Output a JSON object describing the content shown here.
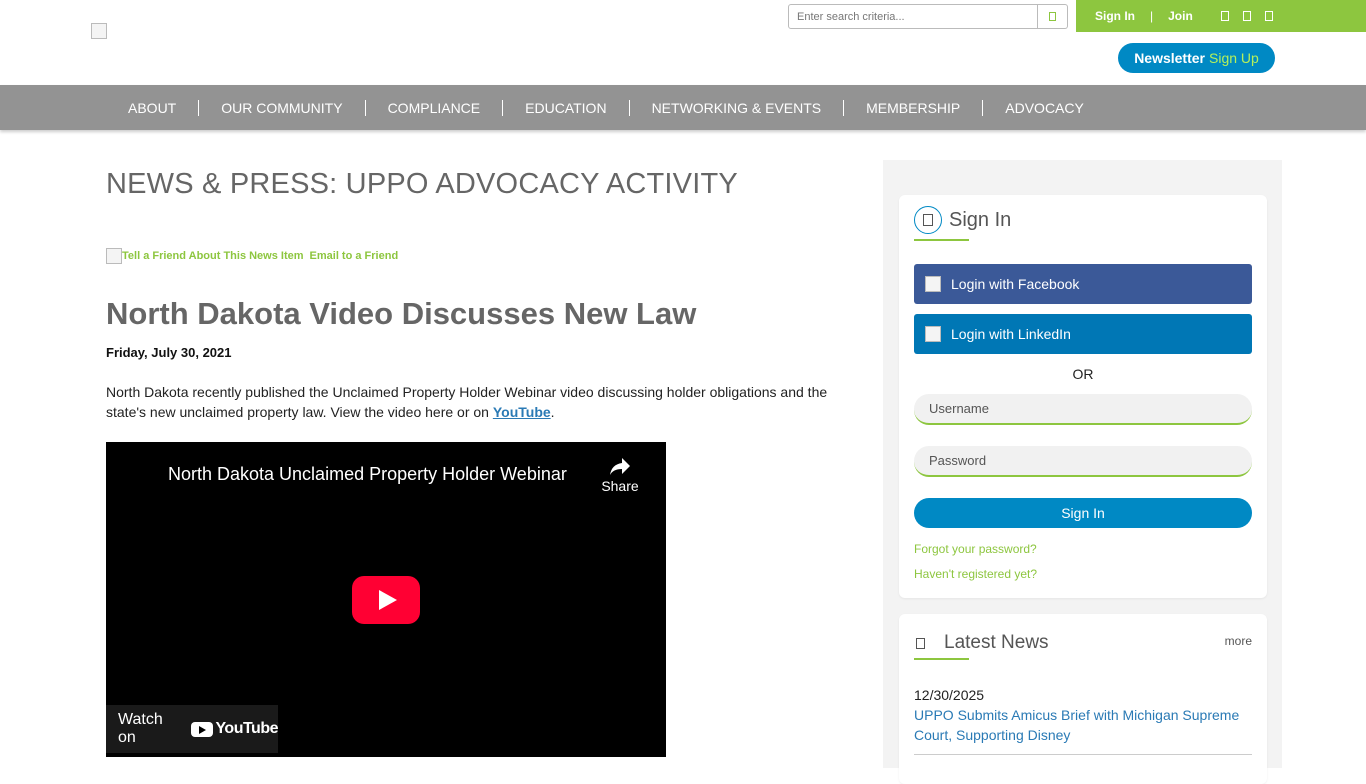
{
  "header": {
    "search_placeholder": "Enter search criteria...",
    "sign_in": "Sign In",
    "join": "Join",
    "separator": "|",
    "newsletter_bold": "Newsletter",
    "newsletter_light": "Sign Up"
  },
  "nav": {
    "items": [
      "ABOUT",
      "OUR COMMUNITY",
      "COMPLIANCE",
      "EDUCATION",
      "NETWORKING & EVENTS",
      "MEMBERSHIP",
      "ADVOCACY"
    ]
  },
  "main": {
    "page_title": "NEWS & PRESS: UPPO ADVOCACY ACTIVITY",
    "tell_friend_alt": "Tell a Friend About This News Item",
    "email_friend": "Email to a Friend",
    "article_title": "North Dakota Video Discusses New Law",
    "date": "Friday, July 30, 2021",
    "body_before": "North Dakota recently published the Unclaimed Property Holder Webinar video discussing holder obligations and the state's new unclaimed property law. View the video here or on ",
    "body_link": "YouTube",
    "body_after": ".",
    "video": {
      "title": "North Dakota Unclaimed Property Holder Webinar",
      "share": "Share",
      "watch_on": "Watch on",
      "youtube": "YouTube"
    }
  },
  "sidebar": {
    "signin": {
      "title": "Sign In",
      "facebook": "Login with Facebook",
      "linkedin": "Login with LinkedIn",
      "or": "OR",
      "username_placeholder": "Username",
      "password_placeholder": "Password",
      "submit": "Sign In",
      "forgot": "Forgot your password?",
      "not_registered": "Haven't registered yet?"
    },
    "news": {
      "title": "Latest News",
      "more": "more",
      "items": [
        {
          "date": "12/30/2025",
          "title": "UPPO Submits Amicus Brief with Michigan Supreme Court, Supporting Disney"
        }
      ]
    }
  },
  "colors": {
    "green": "#8dc63f",
    "blue": "#0089c4",
    "nav_gray": "#939393",
    "facebook": "#3b5998",
    "linkedin": "#0077b5"
  }
}
